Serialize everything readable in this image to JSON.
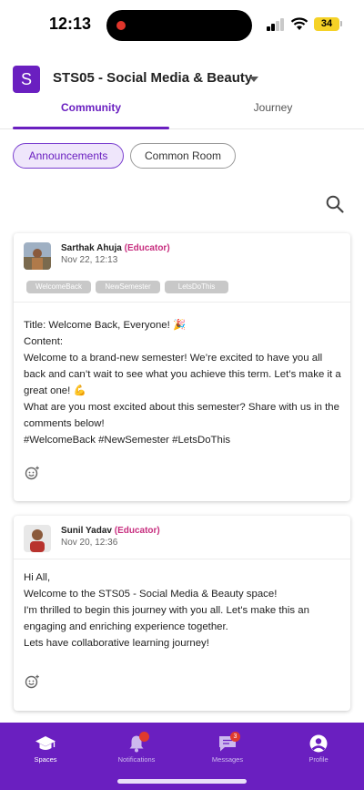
{
  "status_bar": {
    "time": "12:13",
    "battery": "34"
  },
  "header": {
    "space_initial": "S",
    "space_title": "STS05 - Social Media & Beauty"
  },
  "tabs": [
    {
      "label": "Community"
    },
    {
      "label": "Journey"
    }
  ],
  "filters": {
    "announcements": "Announcements",
    "common_room": "Common Room"
  },
  "posts": [
    {
      "author": "Sarthak Ahuja",
      "role": "(Educator)",
      "date": "Nov 22, 12:13",
      "tags": [
        "WelcomeBack",
        "NewSemester",
        "LetsDoThis"
      ],
      "body": "Title: Welcome Back, Everyone! 🎉\nContent:\nWelcome to a brand-new semester! We’re excited to have you all back and can’t wait to see what you achieve this term. Let’s make it a great one! 💪\nWhat are you most excited about this semester? Share with us in the comments below!\n#WelcomeBack #NewSemester #LetsDoThis"
    },
    {
      "author": "Sunil Yadav",
      "role": "(Educator)",
      "date": "Nov 20, 12:36",
      "tags": [],
      "body": "Hi All,\nWelcome to the STS05 - Social Media & Beauty space!\nI'm thrilled to begin this journey with you all. Let's make this an engaging and enriching experience together.\nLets have collaborative learning journey!"
    }
  ],
  "bottom_nav": {
    "items": [
      {
        "label": "Spaces",
        "icon": "graduation-cap-icon"
      },
      {
        "label": "Notifications",
        "icon": "bell-icon"
      },
      {
        "label": "Messages",
        "icon": "chat-icon"
      },
      {
        "label": "Profile",
        "icon": "user-icon"
      }
    ],
    "messages_badge": "3"
  },
  "colors": {
    "brand": "#6a1fc0",
    "educator": "#c72d7e",
    "tag_bg": "#c8c8c8"
  }
}
